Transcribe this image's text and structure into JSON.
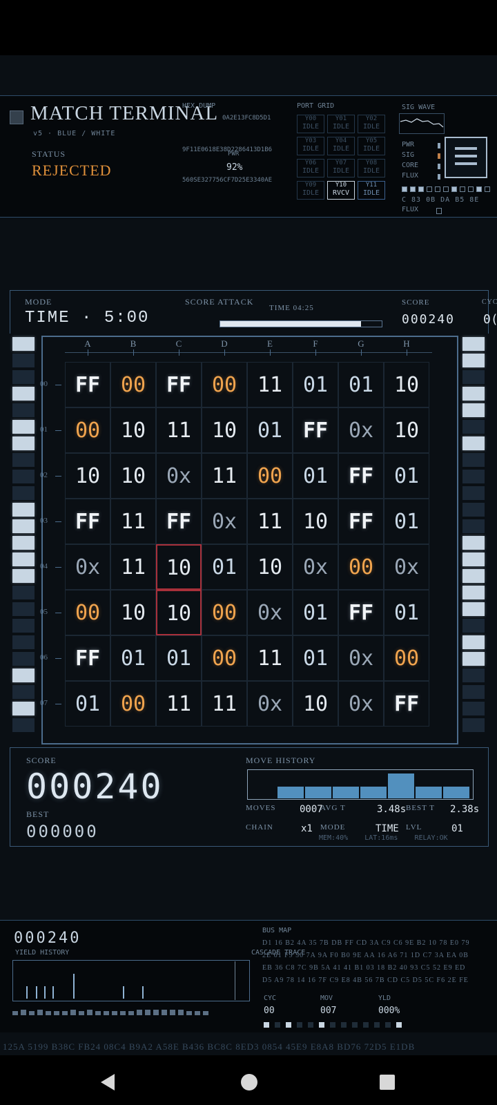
{
  "header": {
    "title": "MATCH TERMINAL",
    "subtitle": "v5 · BLUE / WHITE",
    "status_label": "STATUS",
    "status_value": "REJECTED",
    "hexdump_label": "HEX DUMP",
    "hex_lines": [
      "0A2E13FC8D5D1",
      "9F11E0618E38D2286413D1B6",
      "560SE327756CF7D25E3340AE"
    ],
    "pwr_label": "PWR",
    "pwr_value": "92%",
    "port_grid_label": "PORT GRID",
    "ports": [
      {
        "id": "Y00",
        "state": "IDLE",
        "style": "dim"
      },
      {
        "id": "Y01",
        "state": "IDLE",
        "style": "dim"
      },
      {
        "id": "Y02",
        "state": "IDLE",
        "style": "dim"
      },
      {
        "id": "Y03",
        "state": "IDLE",
        "style": "dim"
      },
      {
        "id": "Y04",
        "state": "IDLE",
        "style": "dim"
      },
      {
        "id": "Y05",
        "state": "IDLE",
        "style": "dim"
      },
      {
        "id": "Y06",
        "state": "IDLE",
        "style": "dim"
      },
      {
        "id": "Y07",
        "state": "IDLE",
        "style": "dim"
      },
      {
        "id": "Y08",
        "state": "IDLE",
        "style": "dim"
      },
      {
        "id": "Y09",
        "state": "IDLE",
        "style": "dim"
      },
      {
        "id": "Y10",
        "state": "RVCV",
        "style": "active"
      },
      {
        "id": "Y11",
        "state": "IDLE",
        "style": "blue"
      }
    ],
    "sig_wave_label": "SIG WAVE",
    "meters": [
      "PWR",
      "SIG",
      "CORE",
      "FLUX"
    ],
    "sig_codes": "C 83 0B DA B5 8E",
    "flux_label": "FLUX"
  },
  "mode_bar": {
    "mode_label": "MODE",
    "mode_value": "TIME · 5:00",
    "center_label": "SCORE ATTACK",
    "time_label": "TIME 04:25",
    "time_fraction": 0.88,
    "score_label": "SCORE",
    "score_value": "000240",
    "cycle_label": "CYC",
    "cycle_value": "0("
  },
  "board": {
    "columns": [
      "A",
      "B",
      "C",
      "D",
      "E",
      "F",
      "G",
      "H"
    ],
    "rows": [
      "00",
      "01",
      "02",
      "03",
      "04",
      "05",
      "06",
      "07"
    ],
    "cells": [
      [
        "FF",
        "00",
        "FF",
        "00",
        "11",
        "01",
        "01",
        "10"
      ],
      [
        "00",
        "10",
        "11",
        "10",
        "01",
        "FF",
        "0x",
        "10"
      ],
      [
        "10",
        "10",
        "0x",
        "11",
        "00",
        "01",
        "FF",
        "01"
      ],
      [
        "FF",
        "11",
        "FF",
        "0x",
        "11",
        "10",
        "FF",
        "01"
      ],
      [
        "0x",
        "11",
        "10",
        "01",
        "10",
        "0x",
        "00",
        "0x"
      ],
      [
        "00",
        "10",
        "10",
        "00",
        "0x",
        "01",
        "FF",
        "01"
      ],
      [
        "FF",
        "01",
        "01",
        "00",
        "11",
        "01",
        "0x",
        "00"
      ],
      [
        "01",
        "00",
        "11",
        "11",
        "0x",
        "10",
        "0x",
        "FF"
      ]
    ],
    "selected": [
      [
        4,
        2
      ],
      [
        5,
        2
      ]
    ]
  },
  "score_panel": {
    "score_label": "SCORE",
    "score_value": "000240",
    "best_label": "BEST",
    "best_value": "000000",
    "history_label": "MOVE HISTORY",
    "history_bars": [
      0,
      0.45,
      0.45,
      0.45,
      0.45,
      0.95,
      0.45,
      0.45
    ],
    "moves_label": "MOVES",
    "moves_value": "0007",
    "avg_label": "AVG T",
    "avg_value": "3.48s",
    "best_t_label": "BEST T",
    "best_t_value": "2.38s",
    "chain_label": "CHAIN",
    "chain_value": "x1",
    "mode_label": "MODE",
    "mode_value": "TIME",
    "lvl_label": "LVL",
    "lvl_value": "01",
    "footer_stats": "MEM:40%    LAT:16ms    RELAY:OK"
  },
  "footer": {
    "score_value": "000240",
    "yield_label": "YIELD HISTORY",
    "cascade_label": "CASCADE TRACE",
    "bus_label": "BUS MAP",
    "bus_lines": [
      "D1 16 B2 4A 35 7B DB FF CD 3A C9 C6 9E B2 10 78 E0 79",
      "2E 61 F9 50 7A 9A F0 B0 9E AA 16 A6 71 1D C7 3A EA 0B",
      "EB 36 C8 7C 9B 5A 41 41 B1 03 18 B2 40 93 C5 52 E9 ED",
      "D5 A9 78 14 16 7F C9 E8 4B 56 7B CD C5 D5 5C F6 2E FE"
    ],
    "cyc_label": "CYC",
    "cyc_value": "00",
    "mov_label": "MOV",
    "mov_value": "007",
    "yld_label": "YLD",
    "yld_value": "000%",
    "hex_ticker": "125A  5199  B38C  FB24  08C4  B9A2  A58E  B436  BC8C  8ED3  0854  45E9  E8A8  BD76  72D5  E1DB"
  },
  "nav": {
    "back": "back-icon",
    "home": "home-icon",
    "recents": "recents-icon"
  }
}
